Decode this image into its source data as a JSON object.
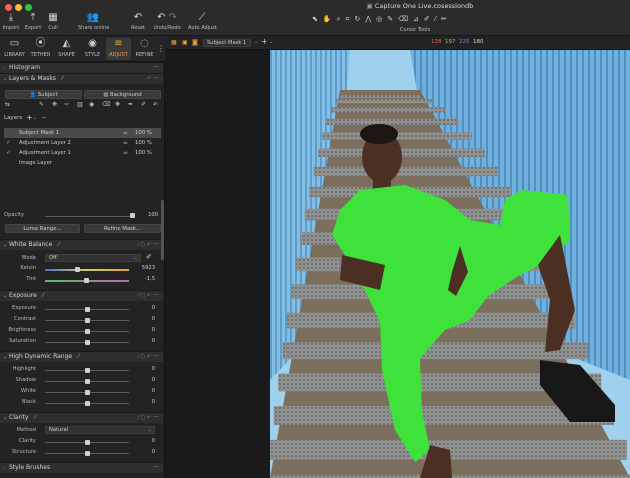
{
  "window": {
    "title": "Capture One Live.cosessiondb",
    "traffic_colors": [
      "#ff5f57",
      "#febc2e",
      "#28c840"
    ]
  },
  "toolbar": {
    "left_buttons": [
      {
        "label": "Import",
        "icon": "import-icon"
      },
      {
        "label": "Export",
        "icon": "export-icon"
      },
      {
        "label": "Cull",
        "icon": "cull-icon"
      }
    ],
    "share_label": "Share online",
    "reset_label": "Reset",
    "undo_redo_label": "Undo/Redo",
    "auto_adjust_label": "Auto Adjust",
    "cursor_tools_label": "Cursor Tools",
    "icon_glyphs": {
      "import": "⤓",
      "export": "⤒",
      "cull": "▦",
      "share": "👥",
      "reset": "↶",
      "undo": "↶",
      "redo": "↷",
      "auto": "⟋"
    }
  },
  "tool_tabs": [
    {
      "label": "LIBRARY",
      "glyph": "▭"
    },
    {
      "label": "TETHER",
      "glyph": "⦿"
    },
    {
      "label": "SHAPE",
      "glyph": "◭"
    },
    {
      "label": "STYLE",
      "glyph": "◉"
    },
    {
      "label": "ADJUST",
      "glyph": "≡"
    },
    {
      "label": "REFINE",
      "glyph": "◌"
    }
  ],
  "active_tab": "ADJUST",
  "viewer_bar": {
    "layer_select": "Subject Mask 1",
    "rgb": {
      "r": "128",
      "g": "197",
      "b": "225",
      "a": "180"
    },
    "rgb_colors": {
      "r": "#e0605a",
      "g": "#7ad06a",
      "b": "#6a8ee6",
      "a": "#d6d6d6"
    }
  },
  "histogram": {
    "title": "Histogram"
  },
  "layers_masks": {
    "title": "Layers & Masks",
    "subject_btn": "Subject",
    "background_btn": "Background",
    "layers_label": "Layers",
    "layers": [
      {
        "name": "Subject Mask 1",
        "opacity": "100 %",
        "selected": true,
        "check": false
      },
      {
        "name": "Adjustment Layer 2",
        "opacity": "100 %",
        "selected": false,
        "check": true
      },
      {
        "name": "Adjustment Layer 1",
        "opacity": "100 %",
        "selected": false,
        "check": true
      },
      {
        "name": "Image Layer",
        "opacity": "",
        "selected": false,
        "check": false
      }
    ],
    "opacity_label": "Opacity",
    "opacity_value": "100",
    "luma_btn": "Luma Range...",
    "refine_btn": "Refine Mask..."
  },
  "white_balance": {
    "title": "White Balance",
    "mode_label": "Mode",
    "mode_value": "Off",
    "kelvin_label": "Kelvin",
    "kelvin_value": "5923",
    "tint_label": "Tint",
    "tint_value": "-1,5"
  },
  "exposure": {
    "title": "Exposure",
    "rows": [
      {
        "label": "Exposure",
        "value": "0"
      },
      {
        "label": "Contrast",
        "value": "0"
      },
      {
        "label": "Brightness",
        "value": "0"
      },
      {
        "label": "Saturation",
        "value": "0"
      }
    ]
  },
  "hdr": {
    "title": "High Dynamic Range",
    "rows": [
      {
        "label": "Highlight",
        "value": "0"
      },
      {
        "label": "Shadow",
        "value": "0"
      },
      {
        "label": "White",
        "value": "0"
      },
      {
        "label": "Black",
        "value": "0"
      }
    ]
  },
  "clarity": {
    "title": "Clarity",
    "method_label": "Method",
    "method_value": "Natural",
    "rows": [
      {
        "label": "Clarity",
        "value": "0"
      },
      {
        "label": "Structure",
        "value": "0"
      }
    ]
  },
  "style_brushes": {
    "title": "Style Brushes"
  },
  "mask_color": "#3fe23a"
}
